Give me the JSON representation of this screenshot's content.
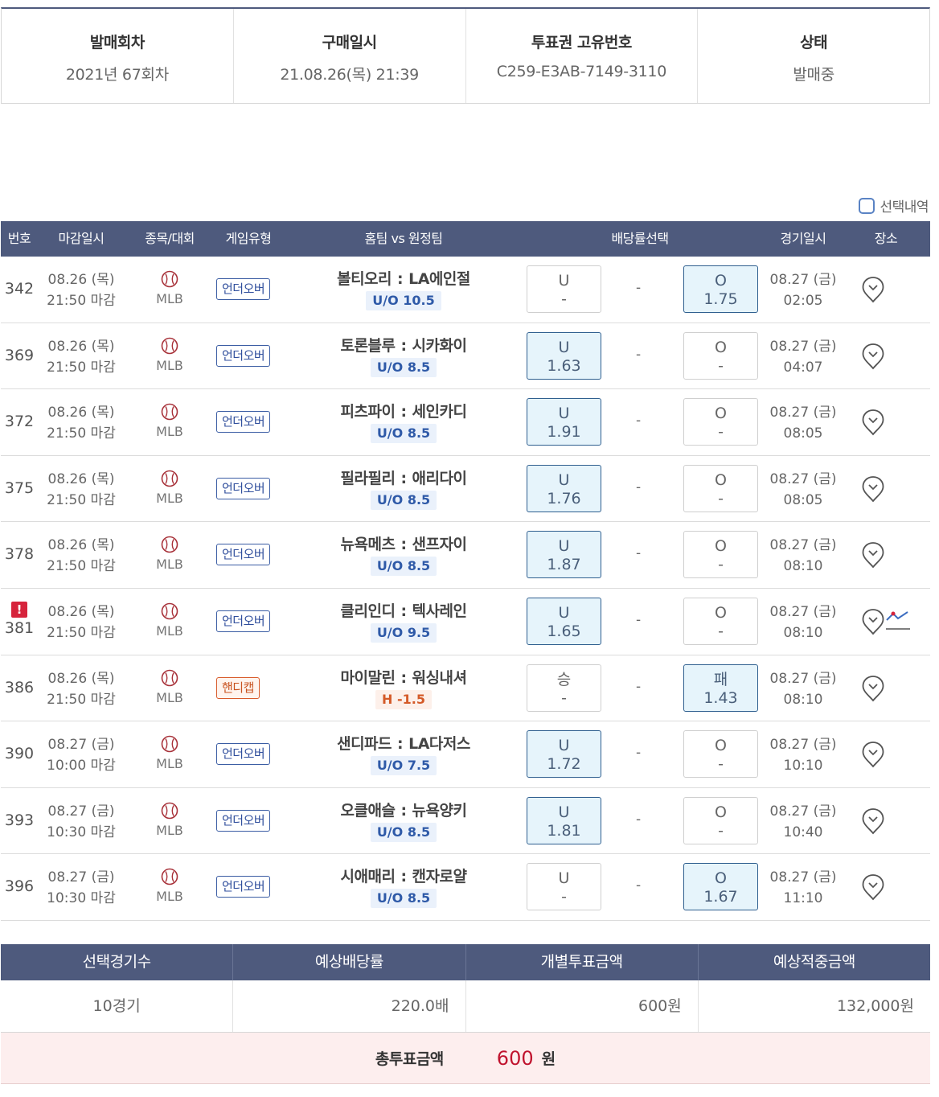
{
  "info": [
    {
      "label": "발매회차",
      "value": "2021년 67회차"
    },
    {
      "label": "구매일시",
      "value": "21.08.26(목) 21:39"
    },
    {
      "label": "투표권 고유번호",
      "value": "C259-E3AB-7149-3110"
    },
    {
      "label": "상태",
      "value": "발매중"
    }
  ],
  "selection_toggle": "선택내역",
  "columns": [
    "번호",
    "마감일시",
    "종목/대회",
    "게임유형",
    "홈팀 vs 원정팀",
    "배당률선택",
    "경기일시",
    "장소"
  ],
  "games": [
    {
      "no": "342",
      "alert": false,
      "deadline_date": "08.26 (목)",
      "deadline_time": "21:50 마감",
      "sport": "MLB",
      "game_type": "언더오버",
      "handicap_type": false,
      "home": "볼티오리",
      "away": "LA에인절",
      "line": "U/O 10.5",
      "left_label": "U",
      "left_value": "-",
      "left_selected": false,
      "mid": "-",
      "right_label": "O",
      "right_value": "1.75",
      "right_selected": true,
      "game_date": "08.27 (금)",
      "game_time": "02:05",
      "chart": false
    },
    {
      "no": "369",
      "alert": false,
      "deadline_date": "08.26 (목)",
      "deadline_time": "21:50 마감",
      "sport": "MLB",
      "game_type": "언더오버",
      "handicap_type": false,
      "home": "토론블루",
      "away": "시카화이",
      "line": "U/O 8.5",
      "left_label": "U",
      "left_value": "1.63",
      "left_selected": true,
      "mid": "-",
      "right_label": "O",
      "right_value": "-",
      "right_selected": false,
      "game_date": "08.27 (금)",
      "game_time": "04:07",
      "chart": false
    },
    {
      "no": "372",
      "alert": false,
      "deadline_date": "08.26 (목)",
      "deadline_time": "21:50 마감",
      "sport": "MLB",
      "game_type": "언더오버",
      "handicap_type": false,
      "home": "피츠파이",
      "away": "세인카디",
      "line": "U/O 8.5",
      "left_label": "U",
      "left_value": "1.91",
      "left_selected": true,
      "mid": "-",
      "right_label": "O",
      "right_value": "-",
      "right_selected": false,
      "game_date": "08.27 (금)",
      "game_time": "08:05",
      "chart": false
    },
    {
      "no": "375",
      "alert": false,
      "deadline_date": "08.26 (목)",
      "deadline_time": "21:50 마감",
      "sport": "MLB",
      "game_type": "언더오버",
      "handicap_type": false,
      "home": "필라필리",
      "away": "애리다이",
      "line": "U/O 8.5",
      "left_label": "U",
      "left_value": "1.76",
      "left_selected": true,
      "mid": "-",
      "right_label": "O",
      "right_value": "-",
      "right_selected": false,
      "game_date": "08.27 (금)",
      "game_time": "08:05",
      "chart": false
    },
    {
      "no": "378",
      "alert": false,
      "deadline_date": "08.26 (목)",
      "deadline_time": "21:50 마감",
      "sport": "MLB",
      "game_type": "언더오버",
      "handicap_type": false,
      "home": "뉴욕메츠",
      "away": "샌프자이",
      "line": "U/O 8.5",
      "left_label": "U",
      "left_value": "1.87",
      "left_selected": true,
      "mid": "-",
      "right_label": "O",
      "right_value": "-",
      "right_selected": false,
      "game_date": "08.27 (금)",
      "game_time": "08:10",
      "chart": false
    },
    {
      "no": "381",
      "alert": true,
      "deadline_date": "08.26 (목)",
      "deadline_time": "21:50 마감",
      "sport": "MLB",
      "game_type": "언더오버",
      "handicap_type": false,
      "home": "클리인디",
      "away": "텍사레인",
      "line": "U/O 9.5",
      "left_label": "U",
      "left_value": "1.65",
      "left_selected": true,
      "mid": "-",
      "right_label": "O",
      "right_value": "-",
      "right_selected": false,
      "game_date": "08.27 (금)",
      "game_time": "08:10",
      "chart": true
    },
    {
      "no": "386",
      "alert": false,
      "deadline_date": "08.26 (목)",
      "deadline_time": "21:50 마감",
      "sport": "MLB",
      "game_type": "핸디캡",
      "handicap_type": true,
      "home": "마이말린",
      "away": "워싱내셔",
      "line": "H -1.5",
      "left_label": "승",
      "left_value": "-",
      "left_selected": false,
      "mid": "-",
      "right_label": "패",
      "right_value": "1.43",
      "right_selected": true,
      "game_date": "08.27 (금)",
      "game_time": "08:10",
      "chart": false
    },
    {
      "no": "390",
      "alert": false,
      "deadline_date": "08.27 (금)",
      "deadline_time": "10:00 마감",
      "sport": "MLB",
      "game_type": "언더오버",
      "handicap_type": false,
      "home": "샌디파드",
      "away": "LA다저스",
      "line": "U/O 7.5",
      "left_label": "U",
      "left_value": "1.72",
      "left_selected": true,
      "mid": "-",
      "right_label": "O",
      "right_value": "-",
      "right_selected": false,
      "game_date": "08.27 (금)",
      "game_time": "10:10",
      "chart": false
    },
    {
      "no": "393",
      "alert": false,
      "deadline_date": "08.27 (금)",
      "deadline_time": "10:30 마감",
      "sport": "MLB",
      "game_type": "언더오버",
      "handicap_type": false,
      "home": "오클애슬",
      "away": "뉴욕양키",
      "line": "U/O 8.5",
      "left_label": "U",
      "left_value": "1.81",
      "left_selected": true,
      "mid": "-",
      "right_label": "O",
      "right_value": "-",
      "right_selected": false,
      "game_date": "08.27 (금)",
      "game_time": "10:40",
      "chart": false
    },
    {
      "no": "396",
      "alert": false,
      "deadline_date": "08.27 (금)",
      "deadline_time": "10:30 마감",
      "sport": "MLB",
      "game_type": "언더오버",
      "handicap_type": false,
      "home": "시애매리",
      "away": "캔자로얄",
      "line": "U/O 8.5",
      "left_label": "U",
      "left_value": "-",
      "left_selected": false,
      "mid": "-",
      "right_label": "O",
      "right_value": "1.67",
      "right_selected": true,
      "game_date": "08.27 (금)",
      "game_time": "11:10",
      "chart": false
    }
  ],
  "summary": {
    "headers": [
      "선택경기수",
      "예상배당률",
      "개별투표금액",
      "예상적중금액"
    ],
    "games_count": "10경기",
    "expected_odds": "220.0배",
    "stake": "600원",
    "expected_payout": "132,000원",
    "total_label": "총투표금액",
    "total_value": "600",
    "total_unit": "원"
  },
  "colors": {
    "header_bg": "#4e5a7d",
    "selected_bg": "#e6f4fb",
    "alert": "#d6243c",
    "total_value": "#c0132e"
  }
}
